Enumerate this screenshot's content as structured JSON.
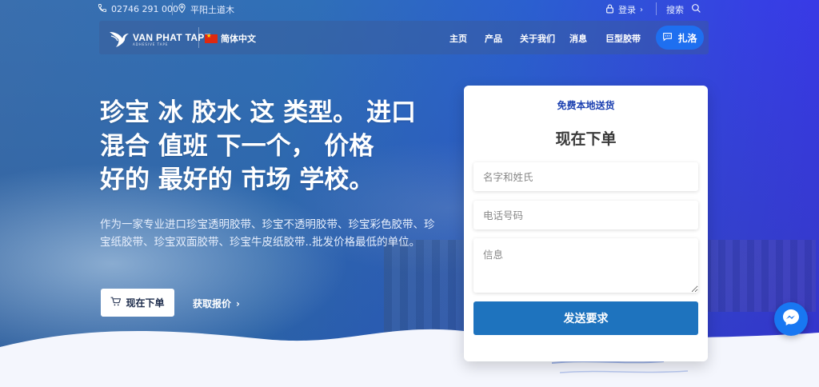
{
  "topbar": {
    "phone": "02746 291 000",
    "location": "平阳土道木",
    "login": "登录",
    "search": "搜索"
  },
  "nav": {
    "logo_text": "VAN PHAT TAPE",
    "logo_sub": "ADHESIVE TAPE",
    "language": "简体中文",
    "menu": [
      "主页",
      "产品",
      "关于我们",
      "消息",
      "巨型胶带"
    ],
    "cta_label": "扎洛"
  },
  "hero": {
    "headline_lines": [
      "珍宝 冰 胶水 这 类型。 进口",
      "混合 值班 下一个， 价格",
      "好的 最好的 市场 学校。"
    ],
    "description": "作为一家专业进口珍宝透明胶带、珍宝不透明胶带、珍宝彩色胶带、珍宝纸胶带、珍宝双面胶带、珍宝牛皮纸胶带..批发价格最低的单位。",
    "order_button": "现在下单",
    "quote_link": "获取报价"
  },
  "form": {
    "subtitle": "免费本地送货",
    "title": "现在下单",
    "name_placeholder": "名字和姓氏",
    "phone_placeholder": "电话号码",
    "message_placeholder": "信息",
    "submit_label": "发送要求"
  },
  "icons": {
    "phone": "phone-icon",
    "location": "location-pin-icon",
    "lock": "lock-icon",
    "search": "search-icon",
    "chat": "chat-bubble-icon",
    "cart": "cart-icon",
    "messenger": "messenger-icon"
  },
  "colors": {
    "accent": "#1e6ff0",
    "submit": "#1e73be",
    "card_subtitle": "#1a3fb0",
    "messenger": "#1877f2"
  }
}
